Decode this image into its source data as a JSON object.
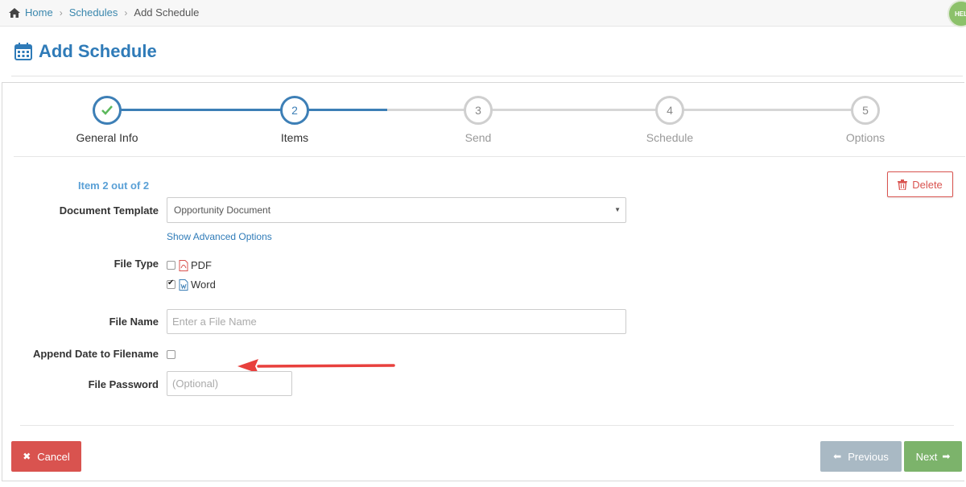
{
  "breadcrumb": {
    "home": "Home",
    "schedules": "Schedules",
    "current": "Add Schedule"
  },
  "avatar": {
    "text": "HEL"
  },
  "page": {
    "title": "Add Schedule"
  },
  "steps": [
    {
      "num": "",
      "label": "General Info",
      "state": "done"
    },
    {
      "num": "2",
      "label": "Items",
      "state": "active"
    },
    {
      "num": "3",
      "label": "Send",
      "state": "pending"
    },
    {
      "num": "4",
      "label": "Schedule",
      "state": "pending"
    },
    {
      "num": "5",
      "label": "Options",
      "state": "pending"
    }
  ],
  "form": {
    "item_count": "Item 2 out of 2",
    "delete_label": "Delete",
    "document_template": {
      "label": "Document Template",
      "value": "Opportunity Document"
    },
    "advanced_link": "Show Advanced Options",
    "file_type": {
      "label": "File Type",
      "pdf": "PDF",
      "word": "Word",
      "pdf_checked": false,
      "word_checked": true
    },
    "file_name": {
      "label": "File Name",
      "placeholder": "Enter a File Name"
    },
    "append_date": {
      "label": "Append Date to Filename",
      "checked": false
    },
    "file_password": {
      "label": "File Password",
      "placeholder": "(Optional)"
    }
  },
  "buttons": {
    "cancel": "Cancel",
    "previous": "Previous",
    "next": "Next"
  },
  "colors": {
    "primary": "#2f7bb8",
    "danger": "#d9534f",
    "success": "#7cb36b",
    "muted": "#a9b9c4"
  }
}
